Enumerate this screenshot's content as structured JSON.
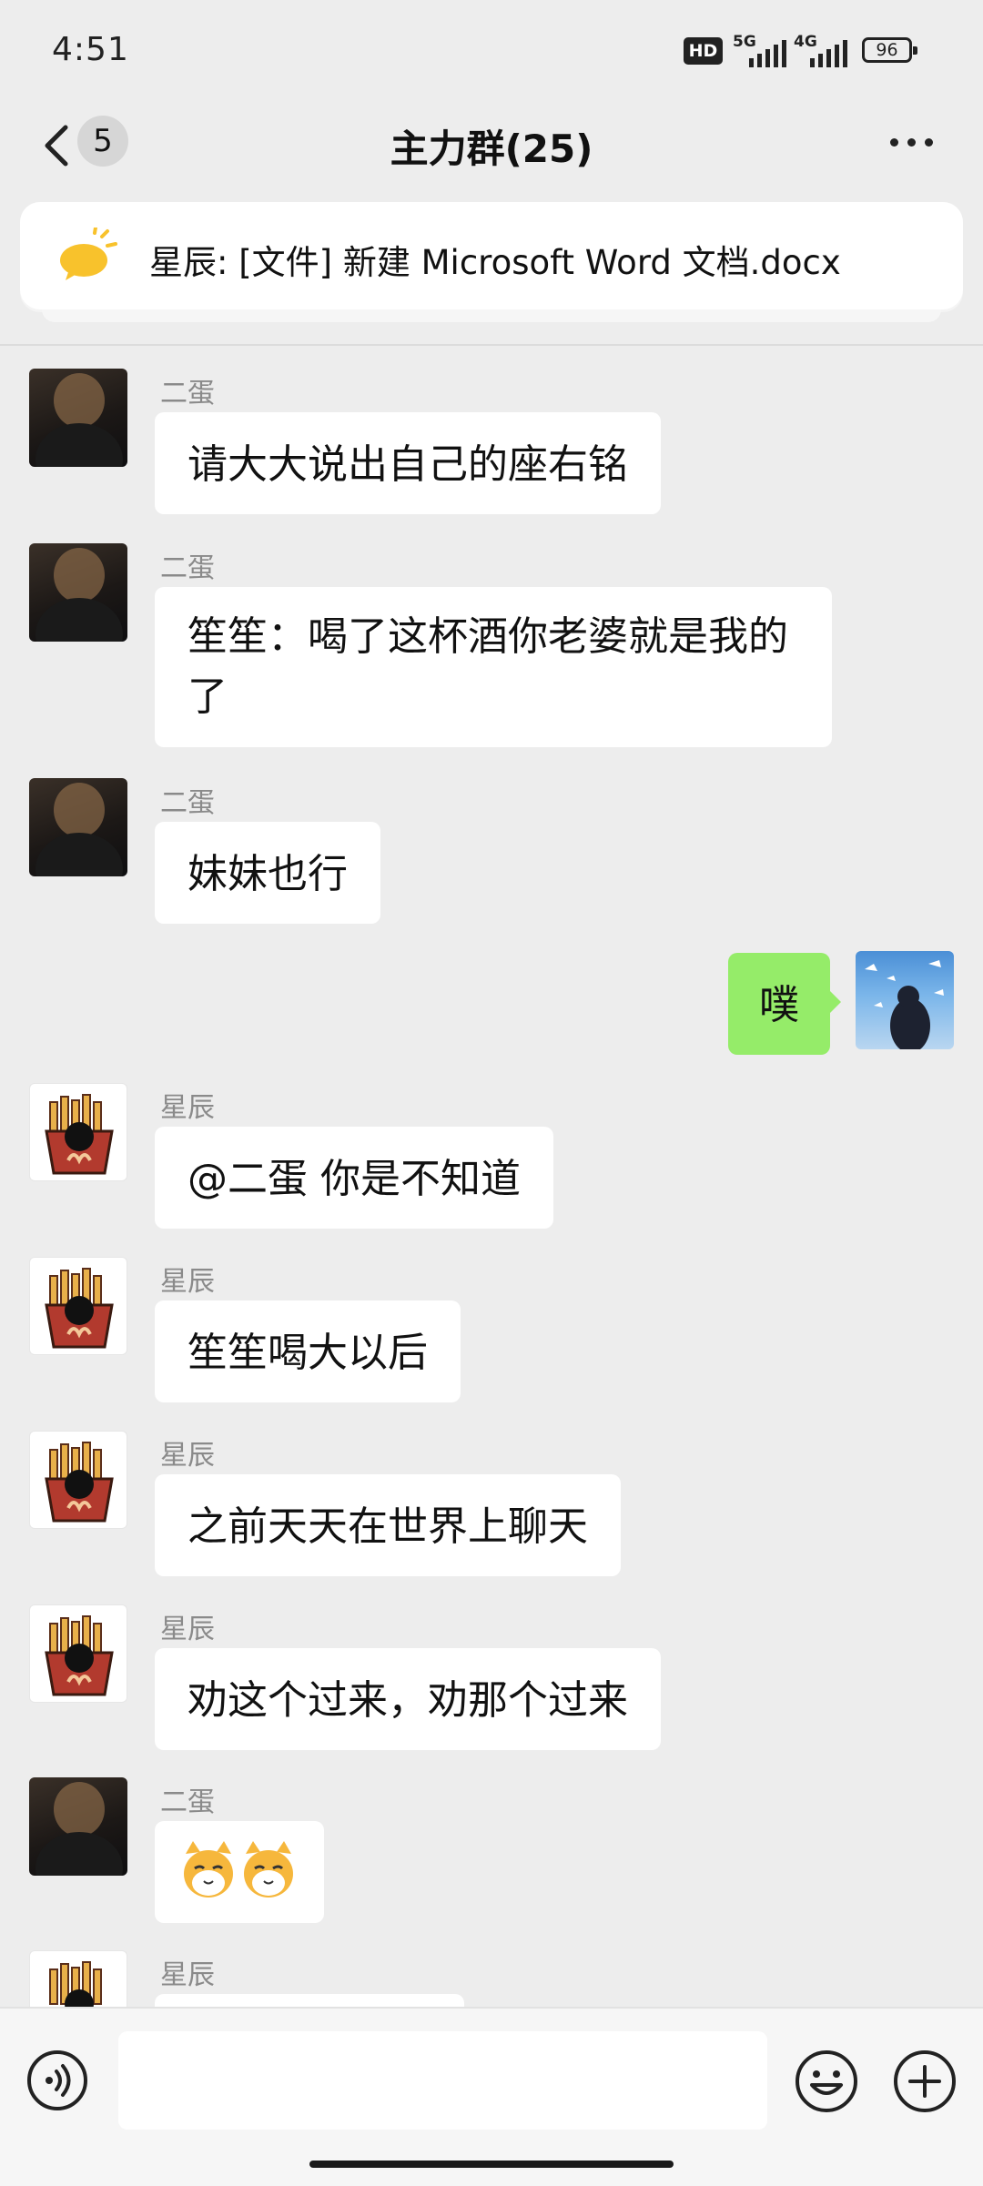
{
  "status_bar": {
    "time": "4:51",
    "hd_label": "HD",
    "sim1_label": "5G",
    "sim2_label": "4G",
    "battery": "96"
  },
  "header": {
    "unread_count": "5",
    "title": "主力群(25)"
  },
  "pinned": {
    "text": "星辰: [文件] 新建 Microsoft Word 文档.docx"
  },
  "messages": [
    {
      "sender": "二蛋",
      "text": "请大大说出自己的座右铭"
    },
    {
      "sender": "二蛋",
      "text_line1": "笙笙：喝了这杯酒你老婆就是我的",
      "text_line2": "了"
    },
    {
      "sender": "二蛋",
      "text": "妹妹也行"
    },
    {
      "sender": "",
      "text": "噗"
    },
    {
      "sender": "星辰",
      "text": "@二蛋  你是不知道"
    },
    {
      "sender": "星辰",
      "text": "笙笙喝大以后"
    },
    {
      "sender": "星辰",
      "text": "之前天天在世界上聊天"
    },
    {
      "sender": "星辰",
      "text": "劝这个过来，劝那个过来"
    },
    {
      "sender": "二蛋",
      "text": "🐱🐱"
    },
    {
      "sender": "星辰",
      "text": ""
    }
  ],
  "input": {
    "value": ""
  },
  "icons": [
    "back-icon",
    "more-icon",
    "announcement-icon",
    "voice-icon",
    "emoji-icon",
    "plus-icon"
  ],
  "colors": {
    "background": "#ededed",
    "bubble_other": "#ffffff",
    "bubble_self": "#95ec69",
    "sender_name": "#8a8a8a"
  }
}
